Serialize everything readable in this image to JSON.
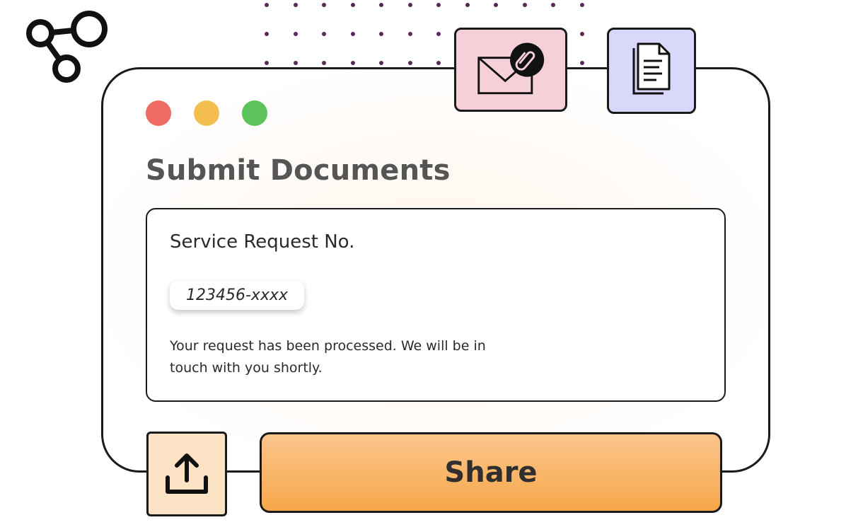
{
  "window": {
    "title": "Submit Documents",
    "controls": [
      "close",
      "minimize",
      "maximize"
    ]
  },
  "card": {
    "label": "Service Request No.",
    "request_number": "123456-xxxx",
    "message": "Your request has been processed. We will be in touch with you shortly."
  },
  "actions": {
    "share_label": "Share",
    "upload_icon": "upload-icon"
  },
  "decor": {
    "mail_icon": "envelope-attachment-icon",
    "docs_icon": "documents-icon",
    "share_nodes_icon": "share-nodes-icon"
  },
  "colors": {
    "traffic_red": "#ee6b63",
    "traffic_yellow": "#f3be4f",
    "traffic_green": "#5cc35b",
    "share_button": "#f7a74a",
    "mail_tile": "#f5d0d8",
    "docs_tile": "#d9d8fb",
    "upload_tile": "#fde3c5",
    "dot_pattern": "#5a2a55"
  }
}
